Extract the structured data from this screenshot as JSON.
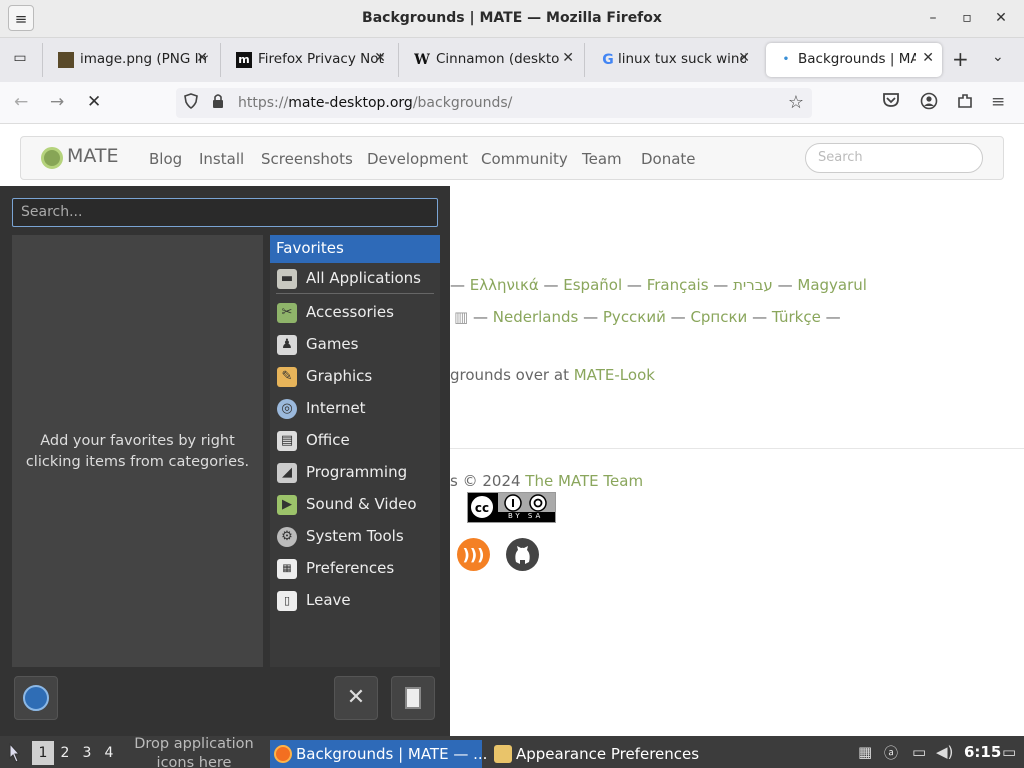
{
  "window": {
    "title": "Backgrounds | MATE — Mozilla Firefox",
    "controls": {
      "menu": "≡",
      "minimize": "–",
      "maximize": "▫",
      "close": "✕"
    }
  },
  "tabs": [
    {
      "label": "image.png (PNG Im",
      "close": "✕",
      "favicon": "img"
    },
    {
      "label": "Firefox Privacy Not",
      "close": "✕",
      "favicon": "m"
    },
    {
      "label": "Cinnamon (deskto",
      "close": "✕",
      "favicon": "W"
    },
    {
      "label": "linux tux suck wind",
      "close": "✕",
      "favicon": "G"
    },
    {
      "label": "Backgrounds | MA",
      "close": "✕",
      "favicon": "•"
    }
  ],
  "tabbar": {
    "new_tab": "+",
    "list_all": "⌄",
    "tab_list": "▭"
  },
  "navbar": {
    "back": "←",
    "forward": "→",
    "stop": "✕",
    "url_prefix": "https://",
    "url_host": "mate-desktop.org",
    "url_path": "/backgrounds/",
    "star": "☆",
    "pocket": "⊽",
    "account": "⊙",
    "extensions": "⧉",
    "menu": "≡"
  },
  "site": {
    "brand": "MATE",
    "nav": [
      "Blog",
      "Install",
      "Screenshots",
      "Development",
      "Community",
      "Team",
      "Donate"
    ],
    "search_placeholder": "Search",
    "lang_line1": [
      "Ελληνικά",
      "Español",
      "Français",
      "עברית",
      "Magyarul"
    ],
    "lang_line2_prefix": "",
    "lang_line2": [
      "Nederlands",
      "Русский",
      "Српски",
      "Türkçe"
    ],
    "dash": "—",
    "more_text": "grounds over at ",
    "more_link": "MATE-Look",
    "copyright_text": "s © 2024 ",
    "copyright_link": "The MATE Team",
    "cc_label": "BY SA",
    "rss": ")))"
  },
  "menu": {
    "search_placeholder": "Search...",
    "favorites_hint": "Add your favorites by right clicking items from categories.",
    "categories": [
      {
        "label": "Favorites",
        "icon": "",
        "selected": true
      },
      {
        "label": "All Applications",
        "icon": "folder-icon"
      },
      {
        "label": "Accessories",
        "icon": "accessories-icon"
      },
      {
        "label": "Games",
        "icon": "games-icon"
      },
      {
        "label": "Graphics",
        "icon": "graphics-icon"
      },
      {
        "label": "Internet",
        "icon": "internet-icon"
      },
      {
        "label": "Office",
        "icon": "office-icon"
      },
      {
        "label": "Programming",
        "icon": "programming-icon"
      },
      {
        "label": "Sound & Video",
        "icon": "sound-video-icon"
      },
      {
        "label": "System Tools",
        "icon": "system-tools-icon"
      },
      {
        "label": "Preferences",
        "icon": "preferences-icon"
      },
      {
        "label": "Leave",
        "icon": "leave-icon"
      }
    ],
    "settings_glyph": "✕"
  },
  "taskbar": {
    "workspaces": [
      "1",
      "2",
      "3",
      "4"
    ],
    "drop_hint": "Drop application icons here",
    "tasks": [
      {
        "label": "Backgrounds | MATE — ...",
        "active": true
      },
      {
        "label": "Appearance Preferences",
        "active": false
      }
    ],
    "clock": "6:15",
    "tray": [
      "▦",
      "ⓐ",
      "▭",
      "◀)",
      "▭"
    ]
  },
  "colors": {
    "accent": "#2e6ab8",
    "link": "#8aa65c",
    "panel": "#3c3c3c"
  }
}
